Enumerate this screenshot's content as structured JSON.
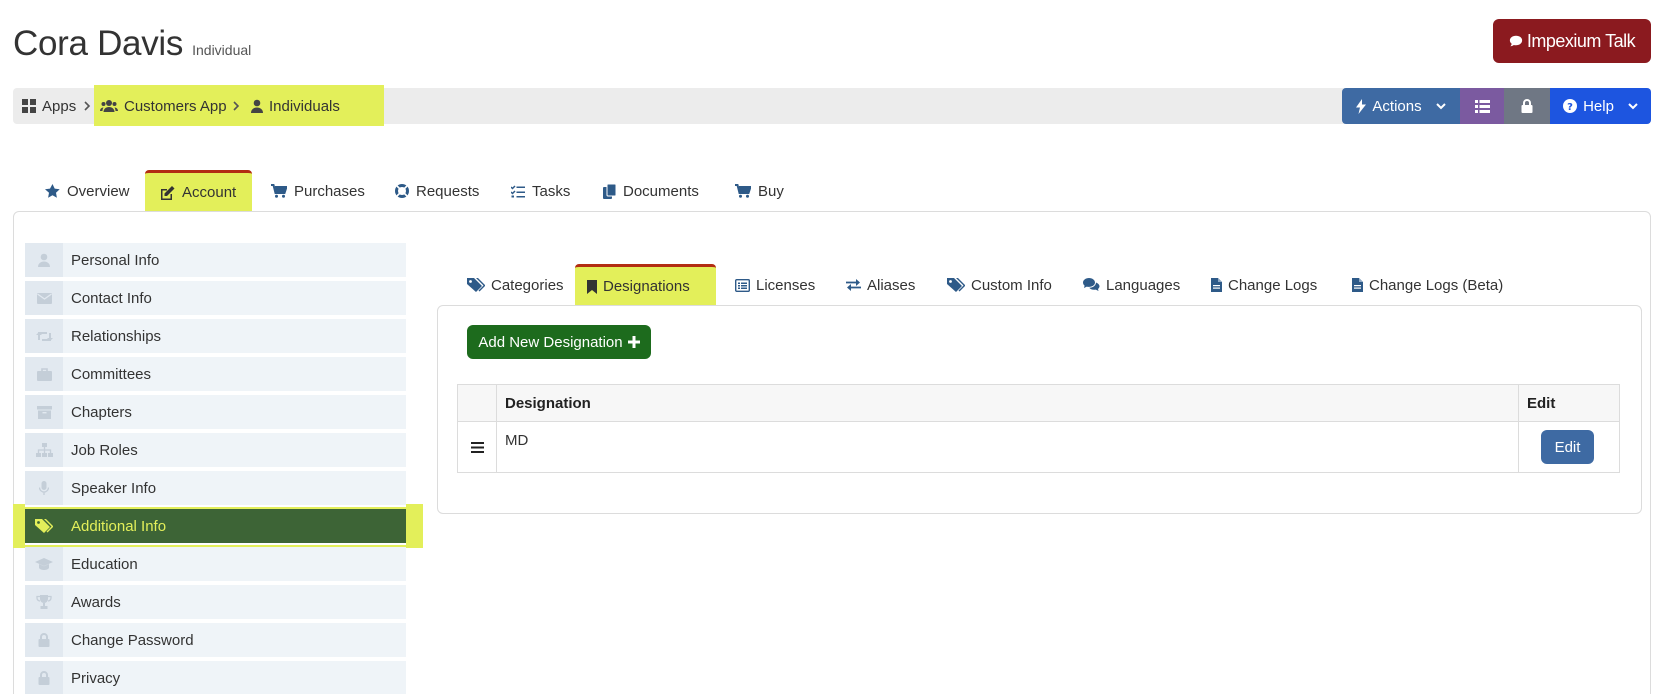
{
  "header": {
    "name": "Cora Davis",
    "record_type": "Individual",
    "talk_button": "Impexium Talk"
  },
  "breadcrumb": [
    {
      "label": "Apps",
      "icon": "grid-icon"
    },
    {
      "label": "Customers App",
      "icon": "users-icon"
    },
    {
      "label": "Individuals",
      "icon": "user-icon"
    }
  ],
  "toolbar": {
    "actions_label": "Actions",
    "help_label": "Help"
  },
  "main_tabs": [
    {
      "label": "Overview",
      "icon": "star-icon"
    },
    {
      "label": "Account",
      "icon": "edit-icon",
      "active": true
    },
    {
      "label": "Purchases",
      "icon": "cart-icon"
    },
    {
      "label": "Requests",
      "icon": "life-ring-icon"
    },
    {
      "label": "Tasks",
      "icon": "tasks-icon"
    },
    {
      "label": "Documents",
      "icon": "copy-icon"
    },
    {
      "label": "Buy",
      "icon": "cart-icon"
    }
  ],
  "sidebar": {
    "items": [
      {
        "label": "Personal Info",
        "icon": "user-icon"
      },
      {
        "label": "Contact Info",
        "icon": "envelope-icon"
      },
      {
        "label": "Relationships",
        "icon": "retweet-icon"
      },
      {
        "label": "Committees",
        "icon": "briefcase-icon"
      },
      {
        "label": "Chapters",
        "icon": "archive-icon"
      },
      {
        "label": "Job Roles",
        "icon": "sitemap-icon"
      },
      {
        "label": "Speaker Info",
        "icon": "microphone-icon"
      },
      {
        "label": "Additional Info",
        "icon": "tags-icon",
        "active": true
      },
      {
        "label": "Education",
        "icon": "graduation-cap-icon"
      },
      {
        "label": "Awards",
        "icon": "trophy-icon"
      },
      {
        "label": "Change Password",
        "icon": "lock-icon"
      },
      {
        "label": "Privacy",
        "icon": "lock-icon"
      }
    ]
  },
  "sub_tabs": [
    {
      "label": "Categories",
      "icon": "tags-icon"
    },
    {
      "label": "Designations",
      "icon": "bookmark-icon",
      "active": true
    },
    {
      "label": "Licenses",
      "icon": "list-alt-icon"
    },
    {
      "label": "Aliases",
      "icon": "exchange-icon"
    },
    {
      "label": "Custom Info",
      "icon": "tags-icon"
    },
    {
      "label": "Languages",
      "icon": "comments-icon"
    },
    {
      "label": "Change Logs",
      "icon": "file-icon"
    },
    {
      "label": "Change Logs (Beta)",
      "icon": "file-icon"
    }
  ],
  "designations": {
    "add_button": "Add New Designation",
    "columns": [
      "Designation",
      "Edit"
    ],
    "rows": [
      {
        "designation": "MD",
        "edit_label": "Edit"
      }
    ]
  },
  "colors": {
    "highlight": "#e3ef5a",
    "active_tab_border": "#b22d12",
    "talk_button": "#8b1a1f",
    "actions_button": "#3e6aa3",
    "list_button": "#7b5aa0",
    "lock_button": "#6f7784",
    "help_button": "#1d55e0",
    "sidebar_active": "#3d6436",
    "add_button": "#1d6b1d"
  }
}
